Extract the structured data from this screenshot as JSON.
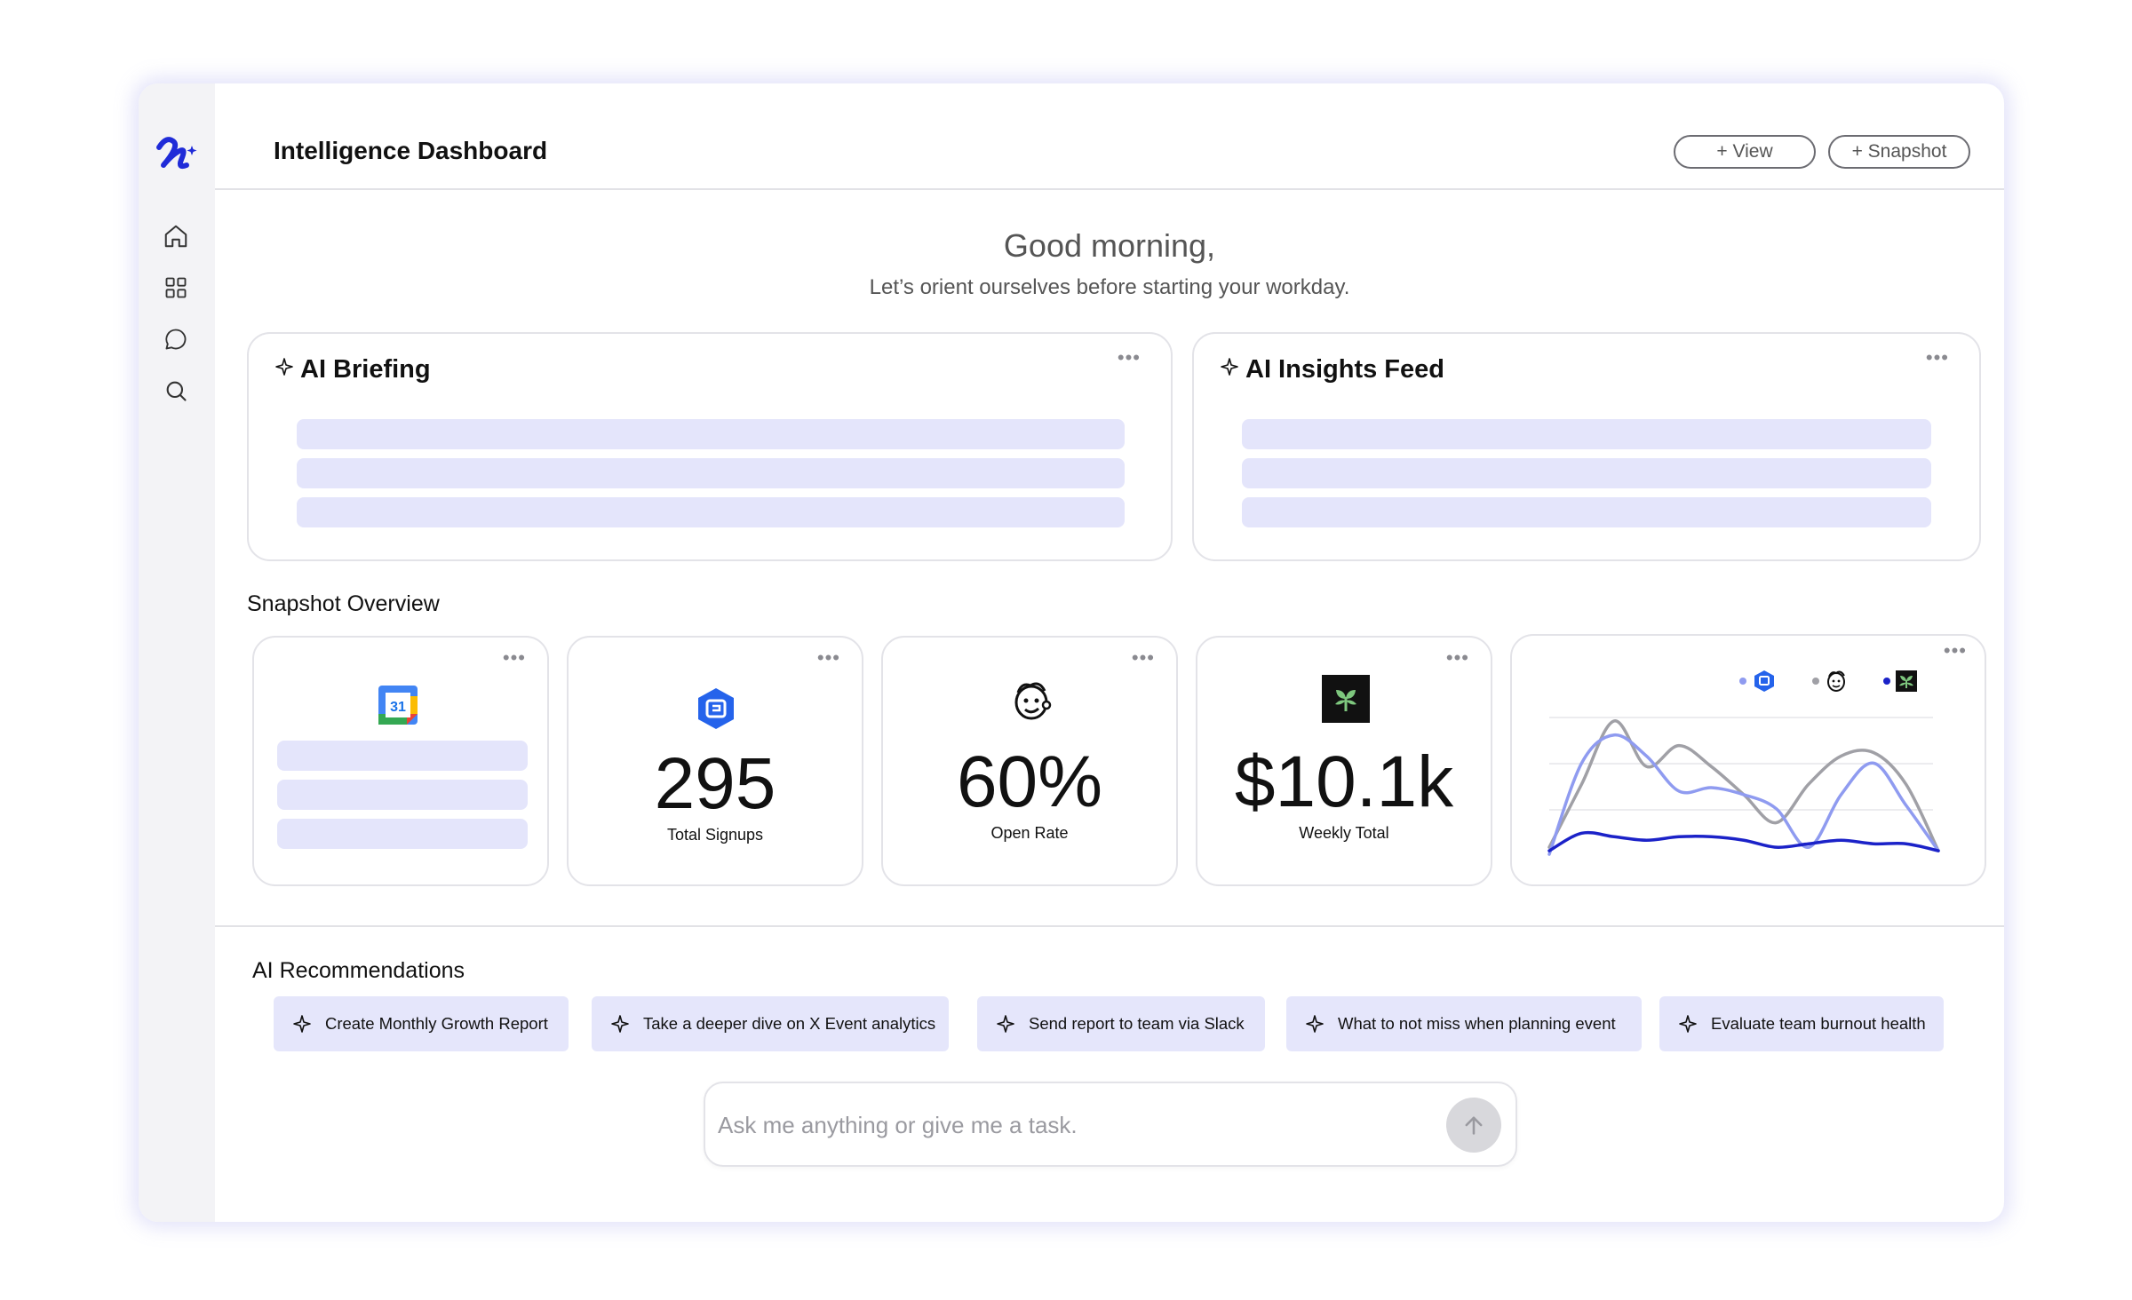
{
  "header": {
    "title": "Intelligence Dashboard",
    "view_button": "+ View",
    "snapshot_button": "+ Snapshot"
  },
  "greeting": {
    "headline": "Good morning,",
    "subtitle": "Let’s orient ourselves before starting your workday."
  },
  "briefing": {
    "title": "AI Briefing",
    "menu": "•••"
  },
  "insights": {
    "title": "AI Insights Feed",
    "menu": "•••"
  },
  "snapshot": {
    "label": "Snapshot Overview",
    "menu": "•••",
    "calendar_icon_text": "31",
    "signups": {
      "value": "295",
      "label": "Total Signups"
    },
    "open_rate": {
      "value": "60%",
      "label": "Open Rate"
    },
    "weekly": {
      "value": "$10.1k",
      "label": "Weekly Total"
    }
  },
  "chart_data": {
    "type": "line",
    "title": "",
    "xlabel": "",
    "ylabel": "",
    "grid": true,
    "legend": "top",
    "series": [
      {
        "icon": "lightblue-brand-icon",
        "color": "#8f9bf0",
        "values": [
          2,
          54,
          70,
          58,
          38,
          40,
          36,
          28,
          6,
          36,
          54,
          30,
          4
        ]
      },
      {
        "icon": "mailchimp-icon",
        "color": "#a0a0a6",
        "values": [
          6,
          42,
          78,
          52,
          64,
          52,
          36,
          20,
          42,
          58,
          60,
          42,
          4
        ]
      },
      {
        "icon": "green-plant-icon",
        "color": "#1b22c8",
        "values": [
          4,
          14,
          12,
          10,
          12,
          12,
          10,
          6,
          8,
          10,
          8,
          8,
          4
        ]
      }
    ]
  },
  "recommendations": {
    "label": "AI Recommendations",
    "items": [
      "Create Monthly Growth Report",
      "Take a deeper dive on X Event analytics",
      "Send report to team via Slack",
      "What to not miss when planning event",
      "Evaluate team burnout health"
    ]
  },
  "ask": {
    "placeholder": "Ask me anything or give me a task."
  }
}
